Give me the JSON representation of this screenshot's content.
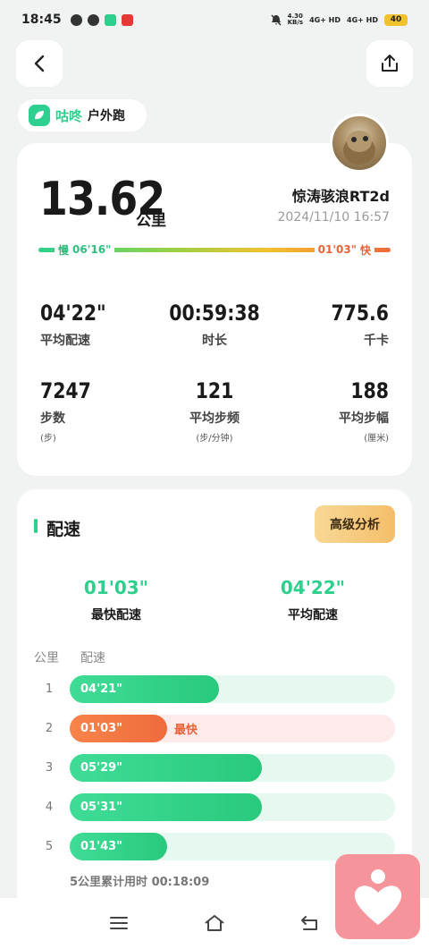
{
  "status_bar": {
    "time": "18:45",
    "net_speed_value": "4.30",
    "net_speed_unit": "KB/s",
    "signal1": "4G+ HD",
    "signal2": "4G+ HD",
    "battery": "40"
  },
  "brand": {
    "name": "咕咚",
    "activity": "户外跑",
    "color": "#2dcf8c"
  },
  "workout": {
    "distance": "13.62",
    "distance_unit": "公里",
    "user": "惊涛骇浪RT2d",
    "datetime": "2024/11/10 16:57",
    "slow_label": "慢",
    "slow_pace": "06'16\"",
    "fast_pace": "01'03\"",
    "fast_label": "快"
  },
  "stats": [
    {
      "value": "04'22\"",
      "label": "平均配速",
      "sub": ""
    },
    {
      "value": "00:59:38",
      "label": "时长",
      "sub": ""
    },
    {
      "value": "775.6",
      "label": "千卡",
      "sub": ""
    },
    {
      "value": "7247",
      "label": "步数",
      "sub": "(步)"
    },
    {
      "value": "121",
      "label": "平均步频",
      "sub": "(步/分钟)"
    },
    {
      "value": "188",
      "label": "平均步幅",
      "sub": "(厘米)"
    }
  ],
  "pace_section": {
    "title": "配速",
    "advanced_button": "高级分析",
    "fastest_value": "01'03\"",
    "fastest_label": "最快配速",
    "average_value": "04'22\"",
    "average_label": "平均配速",
    "col_km": "公里",
    "col_pace": "配速",
    "fastest_tag": "最快",
    "splits": [
      {
        "km": "1",
        "pace": "04'21\"",
        "fraction": 0.46,
        "fastest": false
      },
      {
        "km": "2",
        "pace": "01'03\"",
        "fraction": 0.3,
        "fastest": true
      },
      {
        "km": "3",
        "pace": "05'29\"",
        "fraction": 0.59,
        "fastest": false
      },
      {
        "km": "4",
        "pace": "05'31\"",
        "fraction": 0.59,
        "fastest": false
      },
      {
        "km": "5",
        "pace": "01'43\"",
        "fraction": 0.3,
        "fastest": false
      }
    ],
    "cumulative": "5公里累计用时 00:18:09"
  },
  "icons": {
    "back": "chevron-left-icon",
    "share": "share-icon",
    "nav_menu": "menu-icon",
    "nav_home": "home-icon",
    "nav_back": "back-arrow-icon",
    "fab": "heart-person-icon"
  }
}
